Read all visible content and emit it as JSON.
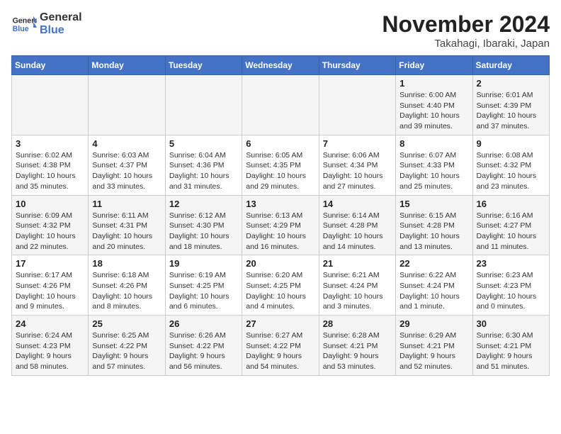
{
  "header": {
    "logo_general": "General",
    "logo_blue": "Blue",
    "month": "November 2024",
    "location": "Takahagi, Ibaraki, Japan"
  },
  "days_of_week": [
    "Sunday",
    "Monday",
    "Tuesday",
    "Wednesday",
    "Thursday",
    "Friday",
    "Saturday"
  ],
  "weeks": [
    [
      {
        "day": "",
        "info": ""
      },
      {
        "day": "",
        "info": ""
      },
      {
        "day": "",
        "info": ""
      },
      {
        "day": "",
        "info": ""
      },
      {
        "day": "",
        "info": ""
      },
      {
        "day": "1",
        "info": "Sunrise: 6:00 AM\nSunset: 4:40 PM\nDaylight: 10 hours and 39 minutes."
      },
      {
        "day": "2",
        "info": "Sunrise: 6:01 AM\nSunset: 4:39 PM\nDaylight: 10 hours and 37 minutes."
      }
    ],
    [
      {
        "day": "3",
        "info": "Sunrise: 6:02 AM\nSunset: 4:38 PM\nDaylight: 10 hours and 35 minutes."
      },
      {
        "day": "4",
        "info": "Sunrise: 6:03 AM\nSunset: 4:37 PM\nDaylight: 10 hours and 33 minutes."
      },
      {
        "day": "5",
        "info": "Sunrise: 6:04 AM\nSunset: 4:36 PM\nDaylight: 10 hours and 31 minutes."
      },
      {
        "day": "6",
        "info": "Sunrise: 6:05 AM\nSunset: 4:35 PM\nDaylight: 10 hours and 29 minutes."
      },
      {
        "day": "7",
        "info": "Sunrise: 6:06 AM\nSunset: 4:34 PM\nDaylight: 10 hours and 27 minutes."
      },
      {
        "day": "8",
        "info": "Sunrise: 6:07 AM\nSunset: 4:33 PM\nDaylight: 10 hours and 25 minutes."
      },
      {
        "day": "9",
        "info": "Sunrise: 6:08 AM\nSunset: 4:32 PM\nDaylight: 10 hours and 23 minutes."
      }
    ],
    [
      {
        "day": "10",
        "info": "Sunrise: 6:09 AM\nSunset: 4:32 PM\nDaylight: 10 hours and 22 minutes."
      },
      {
        "day": "11",
        "info": "Sunrise: 6:11 AM\nSunset: 4:31 PM\nDaylight: 10 hours and 20 minutes."
      },
      {
        "day": "12",
        "info": "Sunrise: 6:12 AM\nSunset: 4:30 PM\nDaylight: 10 hours and 18 minutes."
      },
      {
        "day": "13",
        "info": "Sunrise: 6:13 AM\nSunset: 4:29 PM\nDaylight: 10 hours and 16 minutes."
      },
      {
        "day": "14",
        "info": "Sunrise: 6:14 AM\nSunset: 4:28 PM\nDaylight: 10 hours and 14 minutes."
      },
      {
        "day": "15",
        "info": "Sunrise: 6:15 AM\nSunset: 4:28 PM\nDaylight: 10 hours and 13 minutes."
      },
      {
        "day": "16",
        "info": "Sunrise: 6:16 AM\nSunset: 4:27 PM\nDaylight: 10 hours and 11 minutes."
      }
    ],
    [
      {
        "day": "17",
        "info": "Sunrise: 6:17 AM\nSunset: 4:26 PM\nDaylight: 10 hours and 9 minutes."
      },
      {
        "day": "18",
        "info": "Sunrise: 6:18 AM\nSunset: 4:26 PM\nDaylight: 10 hours and 8 minutes."
      },
      {
        "day": "19",
        "info": "Sunrise: 6:19 AM\nSunset: 4:25 PM\nDaylight: 10 hours and 6 minutes."
      },
      {
        "day": "20",
        "info": "Sunrise: 6:20 AM\nSunset: 4:25 PM\nDaylight: 10 hours and 4 minutes."
      },
      {
        "day": "21",
        "info": "Sunrise: 6:21 AM\nSunset: 4:24 PM\nDaylight: 10 hours and 3 minutes."
      },
      {
        "day": "22",
        "info": "Sunrise: 6:22 AM\nSunset: 4:24 PM\nDaylight: 10 hours and 1 minute."
      },
      {
        "day": "23",
        "info": "Sunrise: 6:23 AM\nSunset: 4:23 PM\nDaylight: 10 hours and 0 minutes."
      }
    ],
    [
      {
        "day": "24",
        "info": "Sunrise: 6:24 AM\nSunset: 4:23 PM\nDaylight: 9 hours and 58 minutes."
      },
      {
        "day": "25",
        "info": "Sunrise: 6:25 AM\nSunset: 4:22 PM\nDaylight: 9 hours and 57 minutes."
      },
      {
        "day": "26",
        "info": "Sunrise: 6:26 AM\nSunset: 4:22 PM\nDaylight: 9 hours and 56 minutes."
      },
      {
        "day": "27",
        "info": "Sunrise: 6:27 AM\nSunset: 4:22 PM\nDaylight: 9 hours and 54 minutes."
      },
      {
        "day": "28",
        "info": "Sunrise: 6:28 AM\nSunset: 4:21 PM\nDaylight: 9 hours and 53 minutes."
      },
      {
        "day": "29",
        "info": "Sunrise: 6:29 AM\nSunset: 4:21 PM\nDaylight: 9 hours and 52 minutes."
      },
      {
        "day": "30",
        "info": "Sunrise: 6:30 AM\nSunset: 4:21 PM\nDaylight: 9 hours and 51 minutes."
      }
    ]
  ]
}
